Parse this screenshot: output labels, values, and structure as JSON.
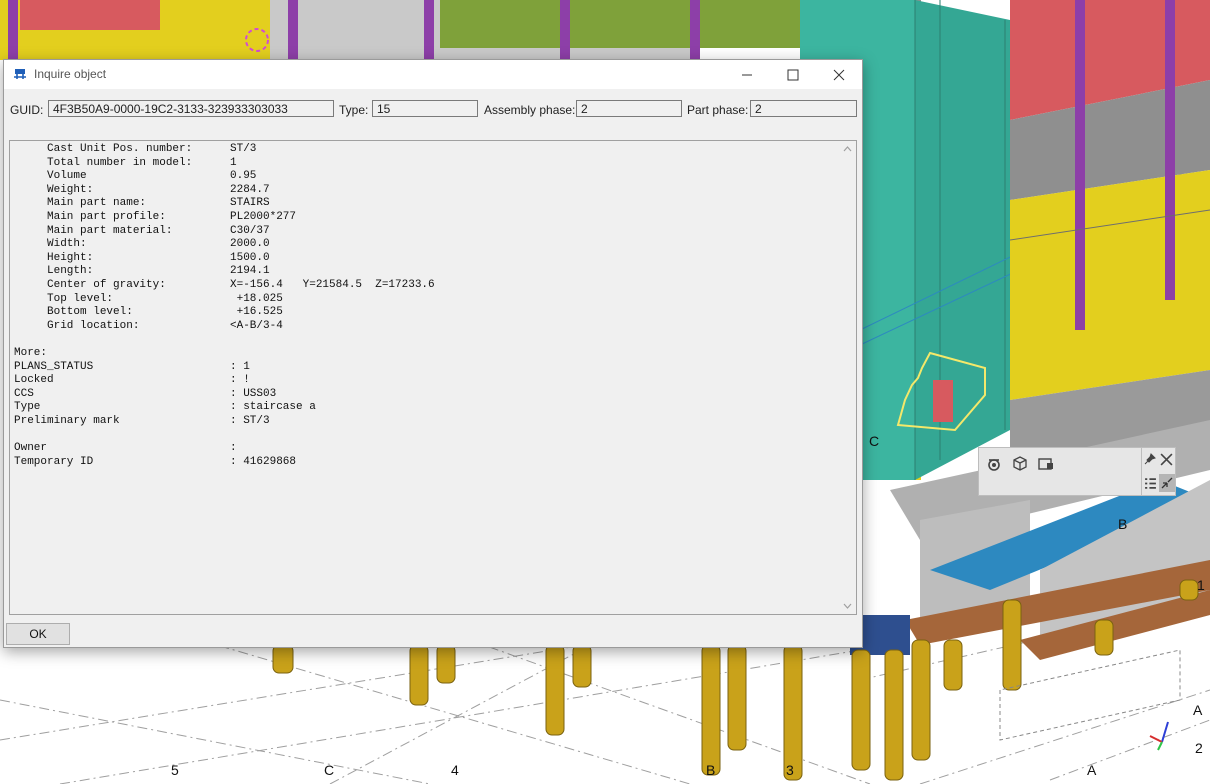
{
  "dialog": {
    "title": "Inquire object",
    "guid_label": "GUID:",
    "guid_value": "4F3B50A9-0000-19C2-3133-323933303033",
    "type_label": "Type:",
    "type_value": "15",
    "assembly_phase_label": "Assembly phase:",
    "assembly_phase_value": "2",
    "part_phase_label": "Part phase:",
    "part_phase_value": "2",
    "ok_label": "OK",
    "report_lines": [
      {
        "key": "     Cast Unit Pos. number:",
        "value": "ST/3"
      },
      {
        "key": "     Total number in model:",
        "value": "1"
      },
      {
        "key": "     Volume",
        "value": "0.95"
      },
      {
        "key": "     Weight:",
        "value": "2284.7"
      },
      {
        "key": "     Main part name:",
        "value": "STAIRS"
      },
      {
        "key": "     Main part profile:",
        "value": "PL2000*277"
      },
      {
        "key": "     Main part material:",
        "value": "C30/37"
      },
      {
        "key": "     Width:",
        "value": "2000.0"
      },
      {
        "key": "     Height:",
        "value": "1500.0"
      },
      {
        "key": "     Length:",
        "value": "2194.1"
      },
      {
        "key": "     Center of gravity:",
        "value": "X=-156.4   Y=21584.5  Z=17233.6"
      },
      {
        "key": "     Top level:",
        "value": " +18.025"
      },
      {
        "key": "     Bottom level:",
        "value": " +16.525"
      },
      {
        "key": "     Grid location:",
        "value": "<A-B/3-4"
      },
      {
        "key": "",
        "value": ""
      },
      {
        "key": "More:",
        "value": ""
      },
      {
        "key": "PLANS_STATUS",
        "value": ": 1"
      },
      {
        "key": "Locked",
        "value": ": !"
      },
      {
        "key": "CCS",
        "value": ": USS03"
      },
      {
        "key": "Type",
        "value": ": staircase a"
      },
      {
        "key": "Preliminary mark",
        "value": ": ST/3"
      },
      {
        "key": "",
        "value": ""
      },
      {
        "key": "Owner",
        "value": ":"
      },
      {
        "key": "Temporary ID",
        "value": ": 41629868"
      }
    ]
  },
  "model_view": {
    "grid_labels": [
      "5",
      "C",
      "4",
      "B",
      "3",
      "A",
      "C",
      "B",
      "A",
      "2",
      "1"
    ]
  },
  "colors": {
    "teal": "#3cb5a0",
    "purple": "#8d3fa8",
    "yellow": "#e3cf1e",
    "red": "#d75a5f",
    "green": "#7fa13a",
    "gray": "#8f8f8f",
    "blue": "#2d89c0",
    "brown": "#a5663a",
    "gold": "#c9a21a"
  }
}
